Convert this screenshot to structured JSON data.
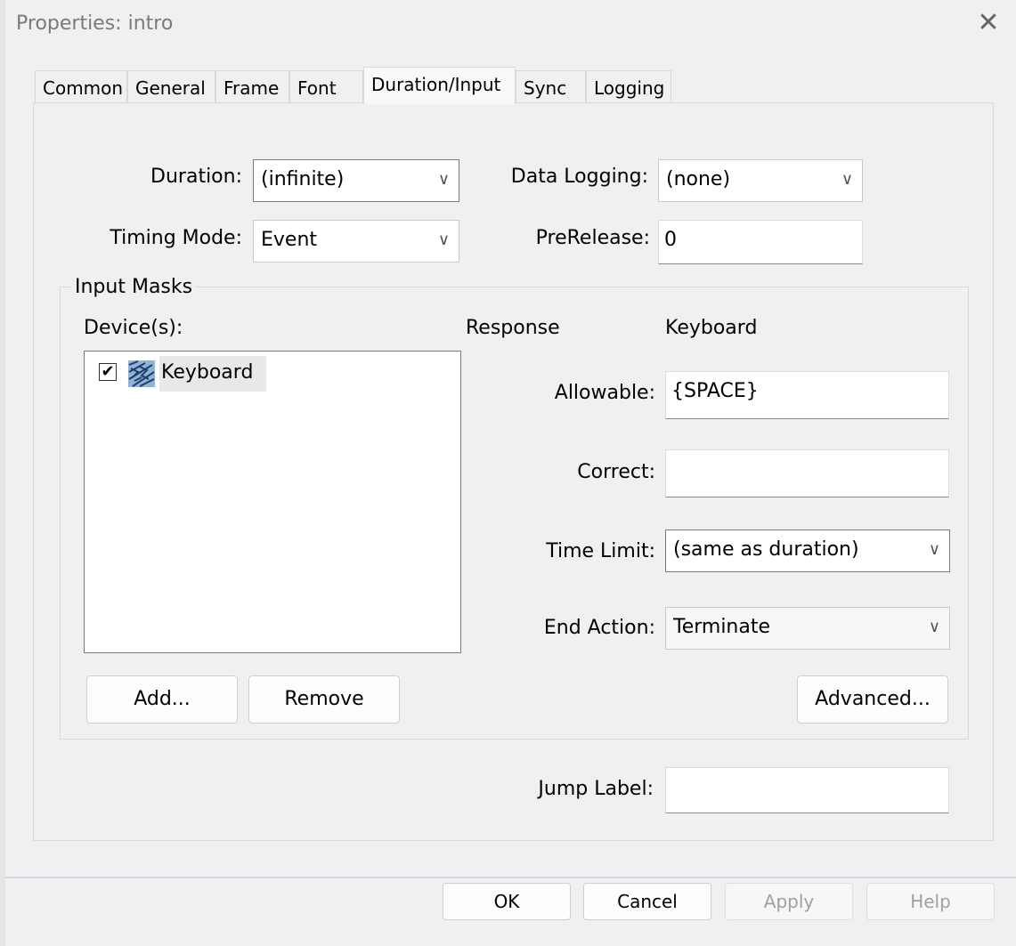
{
  "window": {
    "title": "Properties: intro",
    "close_icon": "close-icon"
  },
  "tabs": [
    {
      "label": "Common"
    },
    {
      "label": "General"
    },
    {
      "label": "Frame"
    },
    {
      "label": "Font"
    },
    {
      "label": "Duration/Input",
      "active": true
    },
    {
      "label": "Sync"
    },
    {
      "label": "Logging"
    }
  ],
  "fields": {
    "duration": {
      "label": "Duration:",
      "value": "(infinite)"
    },
    "timing_mode": {
      "label": "Timing Mode:",
      "value": "Event"
    },
    "data_logging": {
      "label": "Data Logging:",
      "value": "(none)"
    },
    "prerelease": {
      "label": "PreRelease:",
      "value": "0"
    }
  },
  "input_masks": {
    "caption": "Input Masks",
    "devices_label": "Device(s):",
    "devices": [
      {
        "name": "Keyboard",
        "checked": true,
        "icon": "keyboard-icon"
      }
    ],
    "response_header": "Response",
    "device_header": "Keyboard",
    "allowable": {
      "label": "Allowable:",
      "value": "{SPACE}"
    },
    "correct": {
      "label": "Correct:",
      "value": ""
    },
    "time_limit": {
      "label": "Time Limit:",
      "value": "(same as duration)"
    },
    "end_action": {
      "label": "End Action:",
      "value": "Terminate"
    },
    "add_button": "Add...",
    "remove_button": "Remove",
    "advanced_button": "Advanced..."
  },
  "jump_label": {
    "label": "Jump Label:",
    "value": ""
  },
  "footer": {
    "ok": "OK",
    "cancel": "Cancel",
    "apply": "Apply",
    "help": "Help"
  },
  "check_glyph": "✔",
  "arrow_glyph": "∨"
}
